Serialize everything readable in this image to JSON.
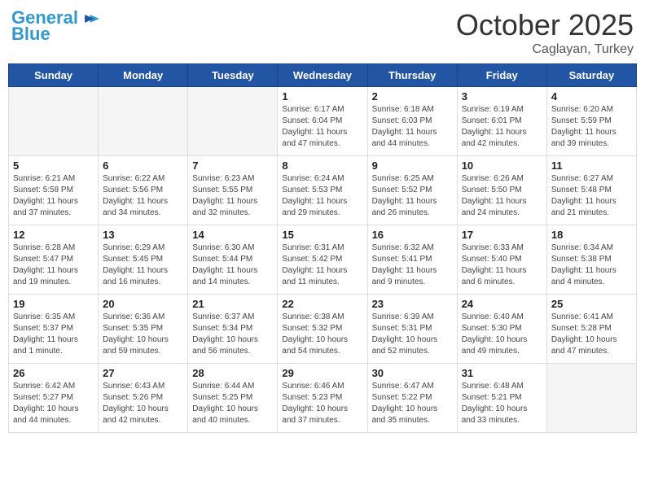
{
  "header": {
    "logo_line1": "General",
    "logo_line2": "Blue",
    "month": "October 2025",
    "location": "Caglayan, Turkey"
  },
  "weekdays": [
    "Sunday",
    "Monday",
    "Tuesday",
    "Wednesday",
    "Thursday",
    "Friday",
    "Saturday"
  ],
  "weeks": [
    [
      {
        "day": "",
        "info": ""
      },
      {
        "day": "",
        "info": ""
      },
      {
        "day": "",
        "info": ""
      },
      {
        "day": "1",
        "info": "Sunrise: 6:17 AM\nSunset: 6:04 PM\nDaylight: 11 hours and 47 minutes."
      },
      {
        "day": "2",
        "info": "Sunrise: 6:18 AM\nSunset: 6:03 PM\nDaylight: 11 hours and 44 minutes."
      },
      {
        "day": "3",
        "info": "Sunrise: 6:19 AM\nSunset: 6:01 PM\nDaylight: 11 hours and 42 minutes."
      },
      {
        "day": "4",
        "info": "Sunrise: 6:20 AM\nSunset: 5:59 PM\nDaylight: 11 hours and 39 minutes."
      }
    ],
    [
      {
        "day": "5",
        "info": "Sunrise: 6:21 AM\nSunset: 5:58 PM\nDaylight: 11 hours and 37 minutes."
      },
      {
        "day": "6",
        "info": "Sunrise: 6:22 AM\nSunset: 5:56 PM\nDaylight: 11 hours and 34 minutes."
      },
      {
        "day": "7",
        "info": "Sunrise: 6:23 AM\nSunset: 5:55 PM\nDaylight: 11 hours and 32 minutes."
      },
      {
        "day": "8",
        "info": "Sunrise: 6:24 AM\nSunset: 5:53 PM\nDaylight: 11 hours and 29 minutes."
      },
      {
        "day": "9",
        "info": "Sunrise: 6:25 AM\nSunset: 5:52 PM\nDaylight: 11 hours and 26 minutes."
      },
      {
        "day": "10",
        "info": "Sunrise: 6:26 AM\nSunset: 5:50 PM\nDaylight: 11 hours and 24 minutes."
      },
      {
        "day": "11",
        "info": "Sunrise: 6:27 AM\nSunset: 5:48 PM\nDaylight: 11 hours and 21 minutes."
      }
    ],
    [
      {
        "day": "12",
        "info": "Sunrise: 6:28 AM\nSunset: 5:47 PM\nDaylight: 11 hours and 19 minutes."
      },
      {
        "day": "13",
        "info": "Sunrise: 6:29 AM\nSunset: 5:45 PM\nDaylight: 11 hours and 16 minutes."
      },
      {
        "day": "14",
        "info": "Sunrise: 6:30 AM\nSunset: 5:44 PM\nDaylight: 11 hours and 14 minutes."
      },
      {
        "day": "15",
        "info": "Sunrise: 6:31 AM\nSunset: 5:42 PM\nDaylight: 11 hours and 11 minutes."
      },
      {
        "day": "16",
        "info": "Sunrise: 6:32 AM\nSunset: 5:41 PM\nDaylight: 11 hours and 9 minutes."
      },
      {
        "day": "17",
        "info": "Sunrise: 6:33 AM\nSunset: 5:40 PM\nDaylight: 11 hours and 6 minutes."
      },
      {
        "day": "18",
        "info": "Sunrise: 6:34 AM\nSunset: 5:38 PM\nDaylight: 11 hours and 4 minutes."
      }
    ],
    [
      {
        "day": "19",
        "info": "Sunrise: 6:35 AM\nSunset: 5:37 PM\nDaylight: 11 hours and 1 minute."
      },
      {
        "day": "20",
        "info": "Sunrise: 6:36 AM\nSunset: 5:35 PM\nDaylight: 10 hours and 59 minutes."
      },
      {
        "day": "21",
        "info": "Sunrise: 6:37 AM\nSunset: 5:34 PM\nDaylight: 10 hours and 56 minutes."
      },
      {
        "day": "22",
        "info": "Sunrise: 6:38 AM\nSunset: 5:32 PM\nDaylight: 10 hours and 54 minutes."
      },
      {
        "day": "23",
        "info": "Sunrise: 6:39 AM\nSunset: 5:31 PM\nDaylight: 10 hours and 52 minutes."
      },
      {
        "day": "24",
        "info": "Sunrise: 6:40 AM\nSunset: 5:30 PM\nDaylight: 10 hours and 49 minutes."
      },
      {
        "day": "25",
        "info": "Sunrise: 6:41 AM\nSunset: 5:28 PM\nDaylight: 10 hours and 47 minutes."
      }
    ],
    [
      {
        "day": "26",
        "info": "Sunrise: 6:42 AM\nSunset: 5:27 PM\nDaylight: 10 hours and 44 minutes."
      },
      {
        "day": "27",
        "info": "Sunrise: 6:43 AM\nSunset: 5:26 PM\nDaylight: 10 hours and 42 minutes."
      },
      {
        "day": "28",
        "info": "Sunrise: 6:44 AM\nSunset: 5:25 PM\nDaylight: 10 hours and 40 minutes."
      },
      {
        "day": "29",
        "info": "Sunrise: 6:46 AM\nSunset: 5:23 PM\nDaylight: 10 hours and 37 minutes."
      },
      {
        "day": "30",
        "info": "Sunrise: 6:47 AM\nSunset: 5:22 PM\nDaylight: 10 hours and 35 minutes."
      },
      {
        "day": "31",
        "info": "Sunrise: 6:48 AM\nSunset: 5:21 PM\nDaylight: 10 hours and 33 minutes."
      },
      {
        "day": "",
        "info": ""
      }
    ]
  ]
}
